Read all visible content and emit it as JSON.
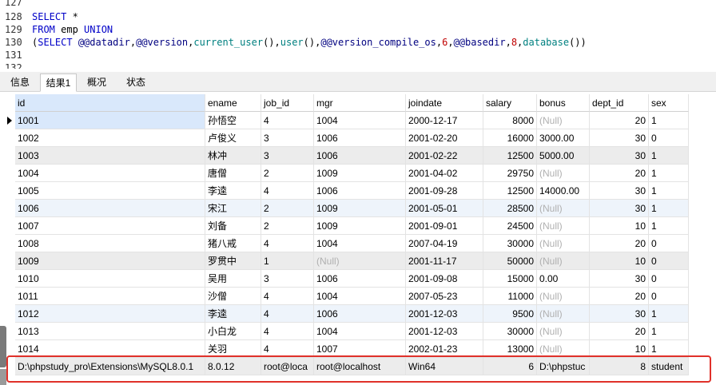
{
  "editor": {
    "lines": [
      {
        "num": "127",
        "tokens": []
      },
      {
        "num": "128",
        "tokens": [
          {
            "t": "SELECT",
            "c": "kw"
          },
          {
            "t": " *",
            "c": "pl"
          }
        ]
      },
      {
        "num": "129",
        "tokens": [
          {
            "t": "FROM",
            "c": "kw"
          },
          {
            "t": " emp ",
            "c": "pl"
          },
          {
            "t": "UNION",
            "c": "kw"
          }
        ]
      },
      {
        "num": "130",
        "tokens": [
          {
            "t": "(",
            "c": "pl"
          },
          {
            "t": "SELECT",
            "c": "kw"
          },
          {
            "t": " ",
            "c": "pl"
          },
          {
            "t": "@@datadir",
            "c": "var"
          },
          {
            "t": ",",
            "c": "pl"
          },
          {
            "t": "@@version",
            "c": "var"
          },
          {
            "t": ",",
            "c": "pl"
          },
          {
            "t": "current_user",
            "c": "fn"
          },
          {
            "t": "(),",
            "c": "pl"
          },
          {
            "t": "user",
            "c": "fn"
          },
          {
            "t": "(),",
            "c": "pl"
          },
          {
            "t": "@@version_compile_os",
            "c": "var"
          },
          {
            "t": ",",
            "c": "pl"
          },
          {
            "t": "6",
            "c": "num"
          },
          {
            "t": ",",
            "c": "pl"
          },
          {
            "t": "@@basedir",
            "c": "var"
          },
          {
            "t": ",",
            "c": "pl"
          },
          {
            "t": "8",
            "c": "num"
          },
          {
            "t": ",",
            "c": "pl"
          },
          {
            "t": "database",
            "c": "fn"
          },
          {
            "t": "())",
            "c": "pl"
          }
        ]
      },
      {
        "num": "131",
        "tokens": []
      },
      {
        "num": "132",
        "tokens": []
      }
    ]
  },
  "tabs": [
    {
      "label": "信息",
      "active": false
    },
    {
      "label": "结果1",
      "active": true
    },
    {
      "label": "概况",
      "active": false
    },
    {
      "label": "状态",
      "active": false
    }
  ],
  "grid": {
    "columns": [
      {
        "key": "id",
        "label": "id",
        "align": "left"
      },
      {
        "key": "ename",
        "label": "ename",
        "align": "left"
      },
      {
        "key": "job_id",
        "label": "job_id",
        "align": "left"
      },
      {
        "key": "mgr",
        "label": "mgr",
        "align": "left"
      },
      {
        "key": "joindate",
        "label": "joindate",
        "align": "left"
      },
      {
        "key": "salary",
        "label": "salary",
        "align": "right"
      },
      {
        "key": "bonus",
        "label": "bonus",
        "align": "left"
      },
      {
        "key": "dept_id",
        "label": "dept_id",
        "align": "right"
      },
      {
        "key": "sex",
        "label": "sex",
        "align": "left"
      }
    ],
    "null_text": "(Null)",
    "rows": [
      [
        "1001",
        "孙悟空",
        "4",
        "1004",
        "2000-12-17",
        "8000",
        null,
        "20",
        "1"
      ],
      [
        "1002",
        "卢俊义",
        "3",
        "1006",
        "2001-02-20",
        "16000",
        "3000.00",
        "30",
        "0"
      ],
      [
        "1003",
        "林冲",
        "3",
        "1006",
        "2001-02-22",
        "12500",
        "5000.00",
        "30",
        "1"
      ],
      [
        "1004",
        "唐僧",
        "2",
        "1009",
        "2001-04-02",
        "29750",
        null,
        "20",
        "1"
      ],
      [
        "1005",
        "李逵",
        "4",
        "1006",
        "2001-09-28",
        "12500",
        "14000.00",
        "30",
        "1"
      ],
      [
        "1006",
        "宋江",
        "2",
        "1009",
        "2001-05-01",
        "28500",
        null,
        "30",
        "1"
      ],
      [
        "1007",
        "刘备",
        "2",
        "1009",
        "2001-09-01",
        "24500",
        null,
        "10",
        "1"
      ],
      [
        "1008",
        "猪八戒",
        "4",
        "1004",
        "2007-04-19",
        "30000",
        null,
        "20",
        "0"
      ],
      [
        "1009",
        "罗贯中",
        "1",
        null,
        "2001-11-17",
        "50000",
        null,
        "10",
        "0"
      ],
      [
        "1010",
        "吴用",
        "3",
        "1006",
        "2001-09-08",
        "15000",
        "0.00",
        "30",
        "0"
      ],
      [
        "1011",
        "沙僧",
        "4",
        "1004",
        "2007-05-23",
        "11000",
        null,
        "20",
        "0"
      ],
      [
        "1012",
        "李逵",
        "4",
        "1006",
        "2001-12-03",
        "9500",
        null,
        "30",
        "1"
      ],
      [
        "1013",
        "小白龙",
        "4",
        "1004",
        "2001-12-03",
        "30000",
        null,
        "20",
        "1"
      ],
      [
        "1014",
        "关羽",
        "4",
        "1007",
        "2002-01-23",
        "13000",
        null,
        "10",
        "1"
      ],
      [
        "D:\\phpstudy_pro\\Extensions\\MySQL8.0.1",
        "8.0.12",
        "root@loca",
        "root@localhost",
        "Win64",
        "6",
        "D:\\phpstuc",
        "8",
        "student"
      ]
    ]
  },
  "colors": {
    "highlight": "#e0312a",
    "header_selected": "#d9e8fb"
  }
}
